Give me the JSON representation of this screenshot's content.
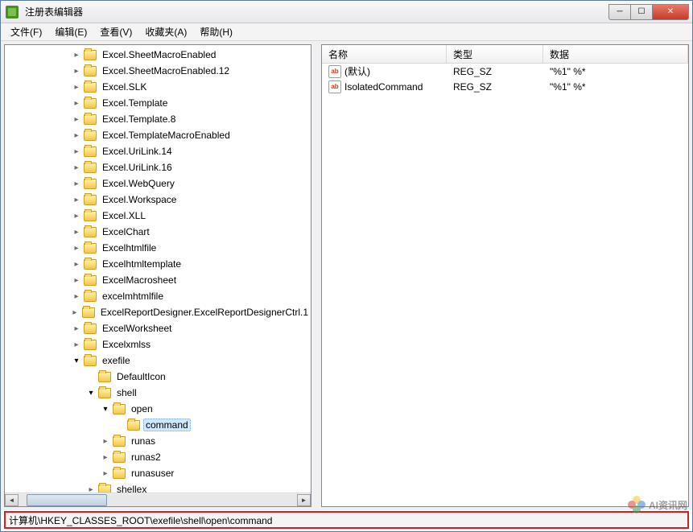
{
  "window": {
    "title": "注册表编辑器"
  },
  "menu": {
    "file": "文件(F)",
    "edit": "编辑(E)",
    "view": "查看(V)",
    "favorites": "收藏夹(A)",
    "help": "帮助(H)"
  },
  "tree": {
    "items": [
      {
        "depth": 3,
        "label": "Excel.SheetMacroEnabled",
        "expand": "closed"
      },
      {
        "depth": 3,
        "label": "Excel.SheetMacroEnabled.12",
        "expand": "closed"
      },
      {
        "depth": 3,
        "label": "Excel.SLK",
        "expand": "closed"
      },
      {
        "depth": 3,
        "label": "Excel.Template",
        "expand": "closed"
      },
      {
        "depth": 3,
        "label": "Excel.Template.8",
        "expand": "closed"
      },
      {
        "depth": 3,
        "label": "Excel.TemplateMacroEnabled",
        "expand": "closed"
      },
      {
        "depth": 3,
        "label": "Excel.UriLink.14",
        "expand": "closed"
      },
      {
        "depth": 3,
        "label": "Excel.UriLink.16",
        "expand": "closed"
      },
      {
        "depth": 3,
        "label": "Excel.WebQuery",
        "expand": "closed"
      },
      {
        "depth": 3,
        "label": "Excel.Workspace",
        "expand": "closed"
      },
      {
        "depth": 3,
        "label": "Excel.XLL",
        "expand": "closed"
      },
      {
        "depth": 3,
        "label": "ExcelChart",
        "expand": "closed"
      },
      {
        "depth": 3,
        "label": "Excelhtmlfile",
        "expand": "closed"
      },
      {
        "depth": 3,
        "label": "Excelhtmltemplate",
        "expand": "closed"
      },
      {
        "depth": 3,
        "label": "ExcelMacrosheet",
        "expand": "closed"
      },
      {
        "depth": 3,
        "label": "excelmhtmlfile",
        "expand": "closed"
      },
      {
        "depth": 3,
        "label": "ExcelReportDesigner.ExcelReportDesignerCtrl.1",
        "expand": "closed"
      },
      {
        "depth": 3,
        "label": "ExcelWorksheet",
        "expand": "closed"
      },
      {
        "depth": 3,
        "label": "Excelxmlss",
        "expand": "closed"
      },
      {
        "depth": 3,
        "label": "exefile",
        "expand": "open"
      },
      {
        "depth": 4,
        "label": "DefaultIcon",
        "expand": "none"
      },
      {
        "depth": 4,
        "label": "shell",
        "expand": "open"
      },
      {
        "depth": 5,
        "label": "open",
        "expand": "open"
      },
      {
        "depth": 6,
        "label": "command",
        "expand": "none",
        "selected": true
      },
      {
        "depth": 5,
        "label": "runas",
        "expand": "closed"
      },
      {
        "depth": 5,
        "label": "runas2",
        "expand": "closed"
      },
      {
        "depth": 5,
        "label": "runasuser",
        "expand": "closed"
      },
      {
        "depth": 4,
        "label": "shellex",
        "expand": "closed"
      }
    ]
  },
  "list": {
    "columns": {
      "name": "名称",
      "type": "类型",
      "data": "数据"
    },
    "col_widths": {
      "name": 155,
      "type": 120,
      "data": 180
    },
    "rows": [
      {
        "name": "(默认)",
        "type": "REG_SZ",
        "data": "\"%1\" %*"
      },
      {
        "name": "IsolatedCommand",
        "type": "REG_SZ",
        "data": "\"%1\" %*"
      }
    ]
  },
  "statusbar": {
    "path": "计算机\\HKEY_CLASSES_ROOT\\exefile\\shell\\open\\command"
  },
  "watermark": {
    "text": "AI资讯网"
  }
}
